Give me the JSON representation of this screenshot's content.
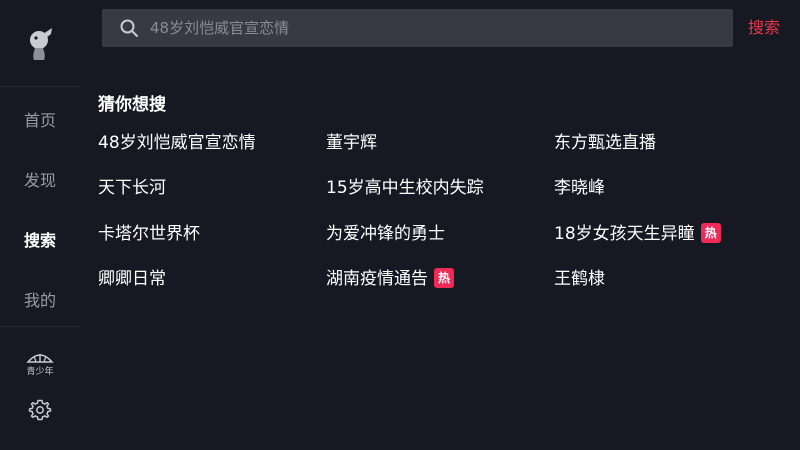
{
  "sidebar": {
    "logo_icon": "douyin-logo-icon",
    "nav": [
      {
        "label": "首页",
        "active": false
      },
      {
        "label": "发现",
        "active": false
      },
      {
        "label": "搜索",
        "active": true
      },
      {
        "label": "我的",
        "active": false
      }
    ],
    "youth_mode_label": "青少年",
    "youth_mode_icon": "umbrella-icon",
    "settings_icon": "gear-icon"
  },
  "search": {
    "placeholder": "48岁刘恺威官宣恋情",
    "button_label": "搜索",
    "icon": "search-icon"
  },
  "guess": {
    "title": "猜你想搜",
    "items": [
      {
        "label": "48岁刘恺威官宣恋情",
        "hot": false
      },
      {
        "label": "董宇辉",
        "hot": false
      },
      {
        "label": "东方甄选直播",
        "hot": false
      },
      {
        "label": "天下长河",
        "hot": false
      },
      {
        "label": "15岁高中生校内失踪",
        "hot": false
      },
      {
        "label": "李晓峰",
        "hot": false
      },
      {
        "label": "卡塔尔世界杯",
        "hot": false
      },
      {
        "label": "为爱冲锋的勇士",
        "hot": false
      },
      {
        "label": "18岁女孩天生异瞳",
        "hot": true
      },
      {
        "label": "卿卿日常",
        "hot": false
      },
      {
        "label": "湖南疫情通告",
        "hot": true
      },
      {
        "label": "王鹤棣",
        "hot": false
      }
    ],
    "hot_badge_label": "热"
  },
  "colors": {
    "accent": "#e8364b",
    "hot_badge": "#f02a57",
    "background": "#161822",
    "search_bg": "#373944"
  }
}
